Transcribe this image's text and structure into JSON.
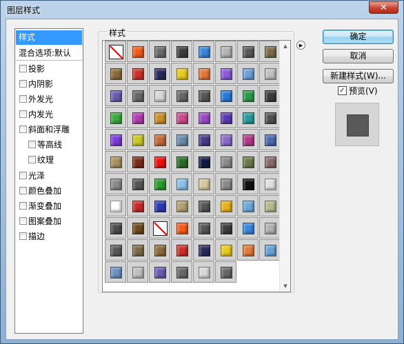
{
  "window": {
    "title": "图层样式",
    "close_glyph": "✕"
  },
  "sidebar": {
    "items": [
      {
        "label": "样式",
        "checkbox": false,
        "indent": false,
        "selected": true
      },
      {
        "label": "混合选项:默认",
        "checkbox": false,
        "indent": false,
        "selected": false
      },
      {
        "label": "投影",
        "checkbox": true,
        "indent": false,
        "selected": false
      },
      {
        "label": "内阴影",
        "checkbox": true,
        "indent": false,
        "selected": false
      },
      {
        "label": "外发光",
        "checkbox": true,
        "indent": false,
        "selected": false
      },
      {
        "label": "内发光",
        "checkbox": true,
        "indent": false,
        "selected": false
      },
      {
        "label": "斜面和浮雕",
        "checkbox": true,
        "indent": false,
        "selected": false
      },
      {
        "label": "等高线",
        "checkbox": true,
        "indent": true,
        "selected": false
      },
      {
        "label": "纹理",
        "checkbox": true,
        "indent": true,
        "selected": false
      },
      {
        "label": "光泽",
        "checkbox": true,
        "indent": false,
        "selected": false
      },
      {
        "label": "颜色叠加",
        "checkbox": true,
        "indent": false,
        "selected": false
      },
      {
        "label": "渐变叠加",
        "checkbox": true,
        "indent": false,
        "selected": false
      },
      {
        "label": "图案叠加",
        "checkbox": true,
        "indent": false,
        "selected": false
      },
      {
        "label": "描边",
        "checkbox": true,
        "indent": false,
        "selected": false
      }
    ]
  },
  "styles_panel": {
    "group_label": "样式",
    "menu_icon": "panel-menu-arrow-icon",
    "swatches": [
      "none",
      "#f05a1a",
      "#6a6a6a",
      "#3b3b3b",
      "#3a86d8",
      "#b4b4b4",
      "#585858",
      "#7a6a4a",
      "#8a6a3c",
      "#c8302a",
      "#2a2a5a",
      "#e8c820",
      "#e0783a",
      "#8a5ad8",
      "#6aa0d8",
      "#c0c0c0",
      "#6a5ab0",
      "#666666",
      "#d6d6d6",
      "#666666",
      "#555555",
      "#2a78d8",
      "#2a9a4a",
      "#3a3a3a",
      "#3aa83a",
      "#b03ab0",
      "#c8902a",
      "#c84a8a",
      "#9a4ac8",
      "#5a3ab0",
      "#2a9a9a",
      "#505050",
      "#7a3ad8",
      "#c8c82a",
      "#c06a3a",
      "#6a8aa8",
      "#4a3a8a",
      "#8a6ac8",
      "#b03a8a",
      "#4a6ab0",
      "#a89060",
      "#7a2a1a",
      "#e81010",
      "#2a6a2a",
      "#101a40",
      "#8a8a8a",
      "#6a7a4a",
      "#8a6a6a",
      "#8a8a8a",
      "#555555",
      "#2a9a2a",
      "#8ac0e8",
      "#d8c8a0",
      "#8a8a8a",
      "#101010",
      "#e0e0e0",
      "#ffffff",
      "#c82a2a",
      "#2a3ab0",
      "#b0a070",
      "#555555",
      "#e8b020",
      "#6aa8d8",
      "#b8b890",
      "#4a4a4a",
      "#6a4a1a",
      "none",
      "#f05a1a",
      "#555555",
      "#3b3b3b",
      "#3a86d8",
      "#b0b0b0",
      "#585858",
      "#7a6a4a",
      "#8a6a3c",
      "#c8302a",
      "#2a2a5a",
      "#e8c820",
      "#e0783a",
      "#6aa0d8",
      "#6a90c0",
      "#c0c0c0",
      "#6a5ab0",
      "#666666",
      "#d6d6d6",
      "#666666"
    ]
  },
  "buttons": {
    "ok": "确定",
    "cancel": "取消",
    "new_style": "新建样式(W)..."
  },
  "preview": {
    "label": "预览(V)",
    "checked": true,
    "check_glyph": "✓"
  }
}
